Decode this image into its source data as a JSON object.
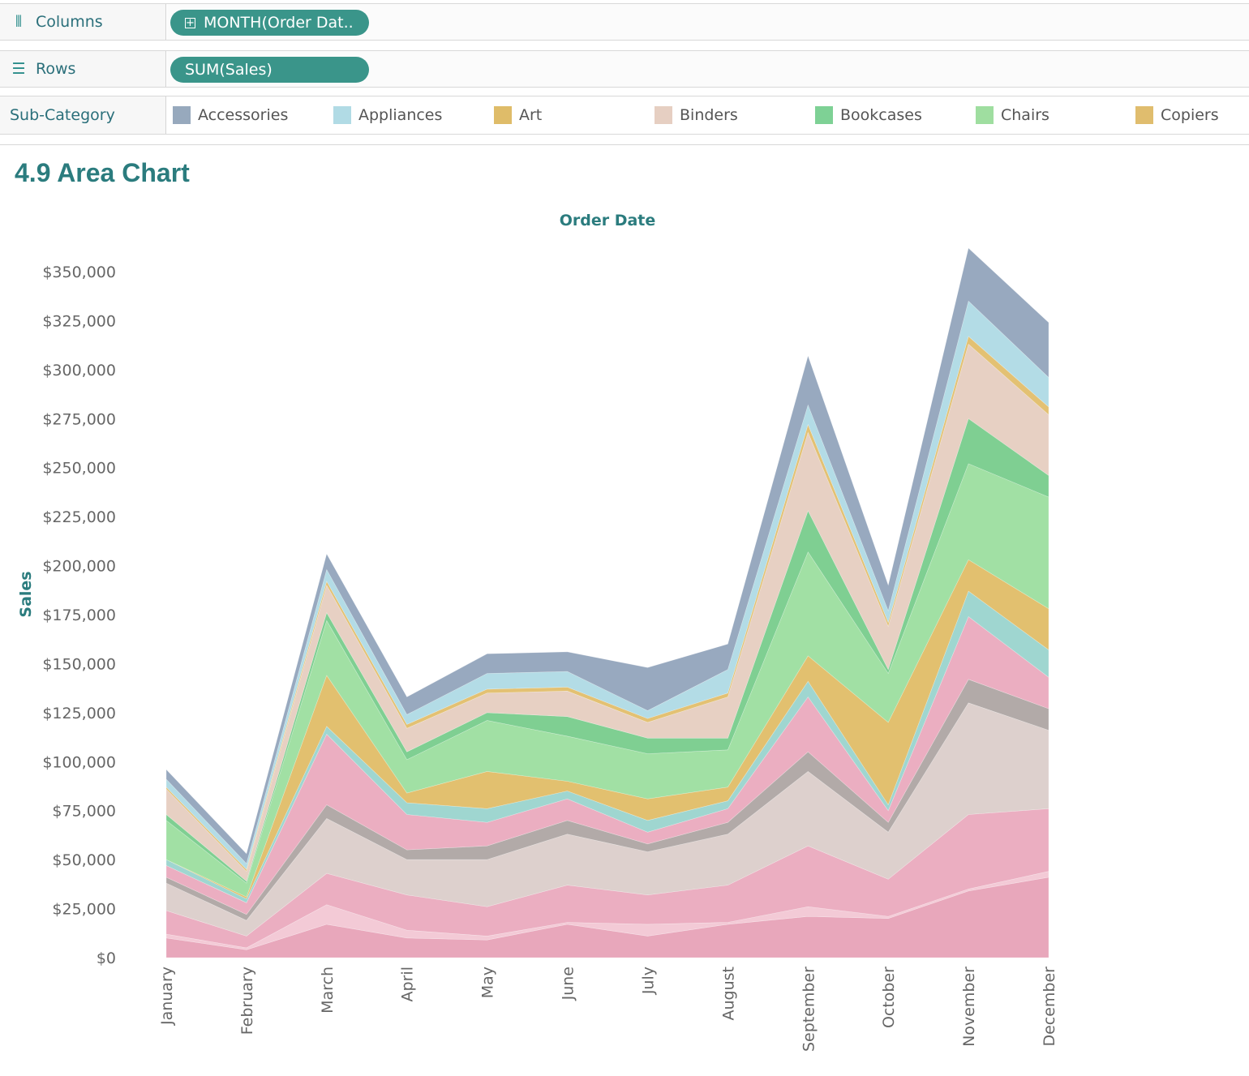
{
  "shelves": {
    "columns": {
      "label": "Columns",
      "pill": "MONTH(Order Dat.."
    },
    "rows": {
      "label": "Rows",
      "pill": "SUM(Sales)"
    },
    "subcategory": {
      "label": "Sub-Category"
    }
  },
  "legend": [
    {
      "name": "Accessories",
      "color": "#97a9bd"
    },
    {
      "name": "Appliances",
      "color": "#b1dbe5"
    },
    {
      "name": "Art",
      "color": "#dfbc69"
    },
    {
      "name": "Binders",
      "color": "#e6cfc2"
    },
    {
      "name": "Bookcases",
      "color": "#7ed195"
    },
    {
      "name": "Chairs",
      "color": "#9fdea0"
    },
    {
      "name": "Copiers",
      "color": "#e0bd6e"
    }
  ],
  "page_title": "4.9 Area Chart",
  "chart_data": {
    "type": "area",
    "stacked": true,
    "x_title": "Order Date",
    "ylabel": "Sales",
    "ylim": [
      0,
      350000
    ],
    "yticks": [
      "$0",
      "$25,000",
      "$50,000",
      "$75,000",
      "$100,000",
      "$125,000",
      "$150,000",
      "$175,000",
      "$200,000",
      "$225,000",
      "$250,000",
      "$275,000",
      "$300,000",
      "$325,000",
      "$350,000"
    ],
    "categories": [
      "January",
      "February",
      "March",
      "April",
      "May",
      "June",
      "July",
      "August",
      "September",
      "October",
      "November",
      "December"
    ],
    "series": [
      {
        "color": "#e8a7bb",
        "values": [
          10000,
          4000,
          17000,
          10000,
          9000,
          17000,
          11000,
          17000,
          21000,
          20000,
          34000,
          41000
        ]
      },
      {
        "color": "#f3cad6",
        "values": [
          2000,
          1000,
          10000,
          4000,
          2000,
          1000,
          6000,
          1000,
          5000,
          1000,
          1000,
          3000
        ]
      },
      {
        "color": "#ebaec1",
        "values": [
          12000,
          6000,
          16000,
          18000,
          15000,
          19000,
          15000,
          19000,
          31000,
          19000,
          38000,
          32000
        ]
      },
      {
        "color": "#ddd0cd",
        "values": [
          14000,
          8000,
          28000,
          18000,
          24000,
          26000,
          22000,
          26000,
          38000,
          24000,
          57000,
          40000
        ]
      },
      {
        "color": "#b2aaa8",
        "values": [
          3000,
          3000,
          7000,
          5000,
          7000,
          7000,
          4000,
          6000,
          10000,
          5000,
          12000,
          11000
        ]
      },
      {
        "color": "#ebaec1",
        "values": [
          6000,
          6000,
          36000,
          18000,
          12000,
          11000,
          6000,
          7000,
          28000,
          6000,
          32000,
          16000
        ]
      },
      {
        "color": "#9fd6d0",
        "values": [
          3000,
          2000,
          4000,
          6000,
          7000,
          4000,
          6000,
          4000,
          8000,
          3000,
          13000,
          14000
        ]
      },
      {
        "color": "#e2c06f",
        "values": [
          0,
          1000,
          26000,
          5000,
          19000,
          5000,
          11000,
          7000,
          13000,
          42000,
          16000,
          21000
        ]
      },
      {
        "color": "#a1e0a4",
        "values": [
          20000,
          7000,
          28000,
          17000,
          26000,
          23000,
          23000,
          19000,
          53000,
          25000,
          49000,
          57000
        ]
      },
      {
        "color": "#7fcf92",
        "values": [
          3000,
          1000,
          4000,
          4000,
          4000,
          10000,
          8000,
          6000,
          21000,
          2000,
          23000,
          11000
        ]
      },
      {
        "color": "#e7d0c3",
        "values": [
          13000,
          5000,
          14000,
          12000,
          10000,
          13000,
          8000,
          21000,
          40000,
          22000,
          38000,
          31000
        ]
      },
      {
        "color": "#e3c173",
        "values": [
          1000,
          1000,
          2000,
          2000,
          2000,
          2000,
          2000,
          2000,
          4000,
          2000,
          4000,
          4000
        ]
      },
      {
        "color": "#b3dce6",
        "values": [
          4000,
          3000,
          6000,
          5000,
          8000,
          8000,
          4000,
          12000,
          10000,
          6000,
          18000,
          15000
        ]
      },
      {
        "color": "#98a9bf",
        "values": [
          5000,
          5000,
          8000,
          9000,
          10000,
          10000,
          22000,
          13000,
          25000,
          13000,
          27000,
          28000
        ]
      }
    ]
  }
}
